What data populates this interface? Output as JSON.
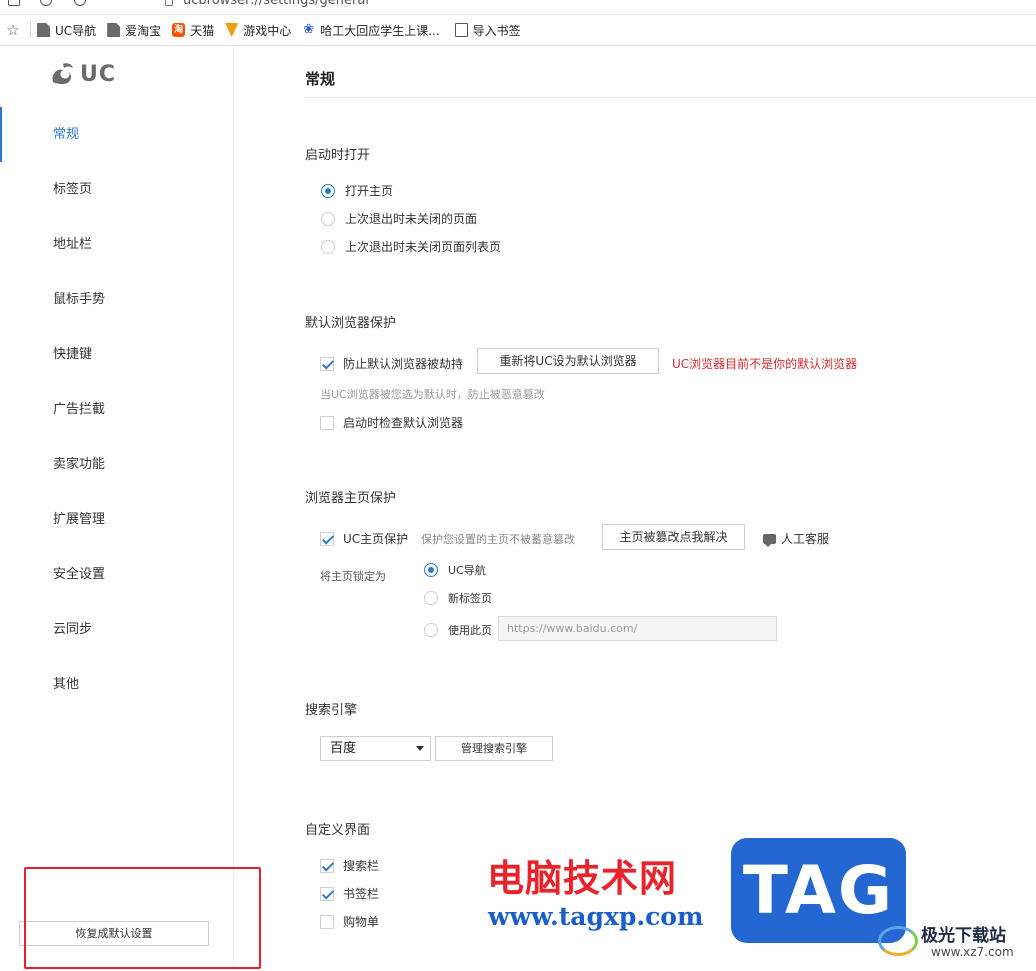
{
  "url_bar": {
    "url": "ucbrowser://settings/general"
  },
  "bookmarks": [
    {
      "label": "UC导航",
      "icon": "page-icon"
    },
    {
      "label": "爱淘宝",
      "icon": "page-icon"
    },
    {
      "label": "天猫",
      "icon": "taobao-icon"
    },
    {
      "label": "游戏中心",
      "icon": "game-icon"
    },
    {
      "label": "哈工大回应学生上课...",
      "icon": "baidu-paw-icon"
    },
    {
      "label": "导入书签",
      "icon": "import-icon"
    }
  ],
  "sidebar": {
    "logo_text": "UC",
    "items": [
      {
        "label": "常规",
        "active": true
      },
      {
        "label": "标签页"
      },
      {
        "label": "地址栏"
      },
      {
        "label": "鼠标手势"
      },
      {
        "label": "快捷键"
      },
      {
        "label": "广告拦截"
      },
      {
        "label": "卖家功能"
      },
      {
        "label": "扩展管理"
      },
      {
        "label": "安全设置"
      },
      {
        "label": "云同步"
      },
      {
        "label": "其他"
      }
    ],
    "reset_label": "恢复成默认设置"
  },
  "main": {
    "title": "常规",
    "startup": {
      "title": "启动时打开",
      "options": [
        {
          "label": "打开主页",
          "checked": true
        },
        {
          "label": "上次退出时未关闭的页面",
          "checked": false
        },
        {
          "label": "上次退出时未关闭页面列表页",
          "checked": false
        }
      ]
    },
    "default_browser": {
      "title": "默认浏览器保护",
      "protect_label": "防止默认浏览器被劫持",
      "protect_checked": true,
      "set_default_button": "重新将UC设为默认浏览器",
      "warning": "UC浏览器目前不是你的默认浏览器",
      "hint": "当UC浏览器被您选为默认时，防止被恶意篡改",
      "check_on_start_label": "启动时检查默认浏览器",
      "check_on_start_checked": false
    },
    "homepage": {
      "title": "浏览器主页保护",
      "protect_label": "UC主页保护",
      "protect_checked": true,
      "protect_hint": "保护您设置的主页不被蓄意篡改",
      "fix_button": "主页被篡改点我解决",
      "service_label": "人工客服",
      "lock_label": "将主页锁定为",
      "lock_options": [
        {
          "label": "UC导航",
          "checked": true
        },
        {
          "label": "新标签页",
          "checked": false
        },
        {
          "label": "使用此页",
          "checked": false
        }
      ],
      "custom_url_placeholder": "https://www.baidu.com/"
    },
    "search": {
      "title": "搜索引擎",
      "selected": "百度",
      "manage_button": "管理搜索引擎"
    },
    "custom_ui": {
      "title": "自定义界面",
      "options": [
        {
          "label": "搜索栏",
          "checked": true
        },
        {
          "label": "书签栏",
          "checked": true
        },
        {
          "label": "购物单",
          "checked": false
        }
      ]
    }
  },
  "watermark": {
    "cn_text": "电脑技术网",
    "url_text": "www.tagxp.com",
    "tag_text": "TAG",
    "site_text": "极光下载站",
    "site_url": "www.xz7.com"
  },
  "colors": {
    "accent": "#2a7ad2",
    "warning": "#d62b2b",
    "highlight_box": "#e5222c",
    "watermark_red": "#e8232b",
    "watermark_blue": "#2467d3"
  }
}
